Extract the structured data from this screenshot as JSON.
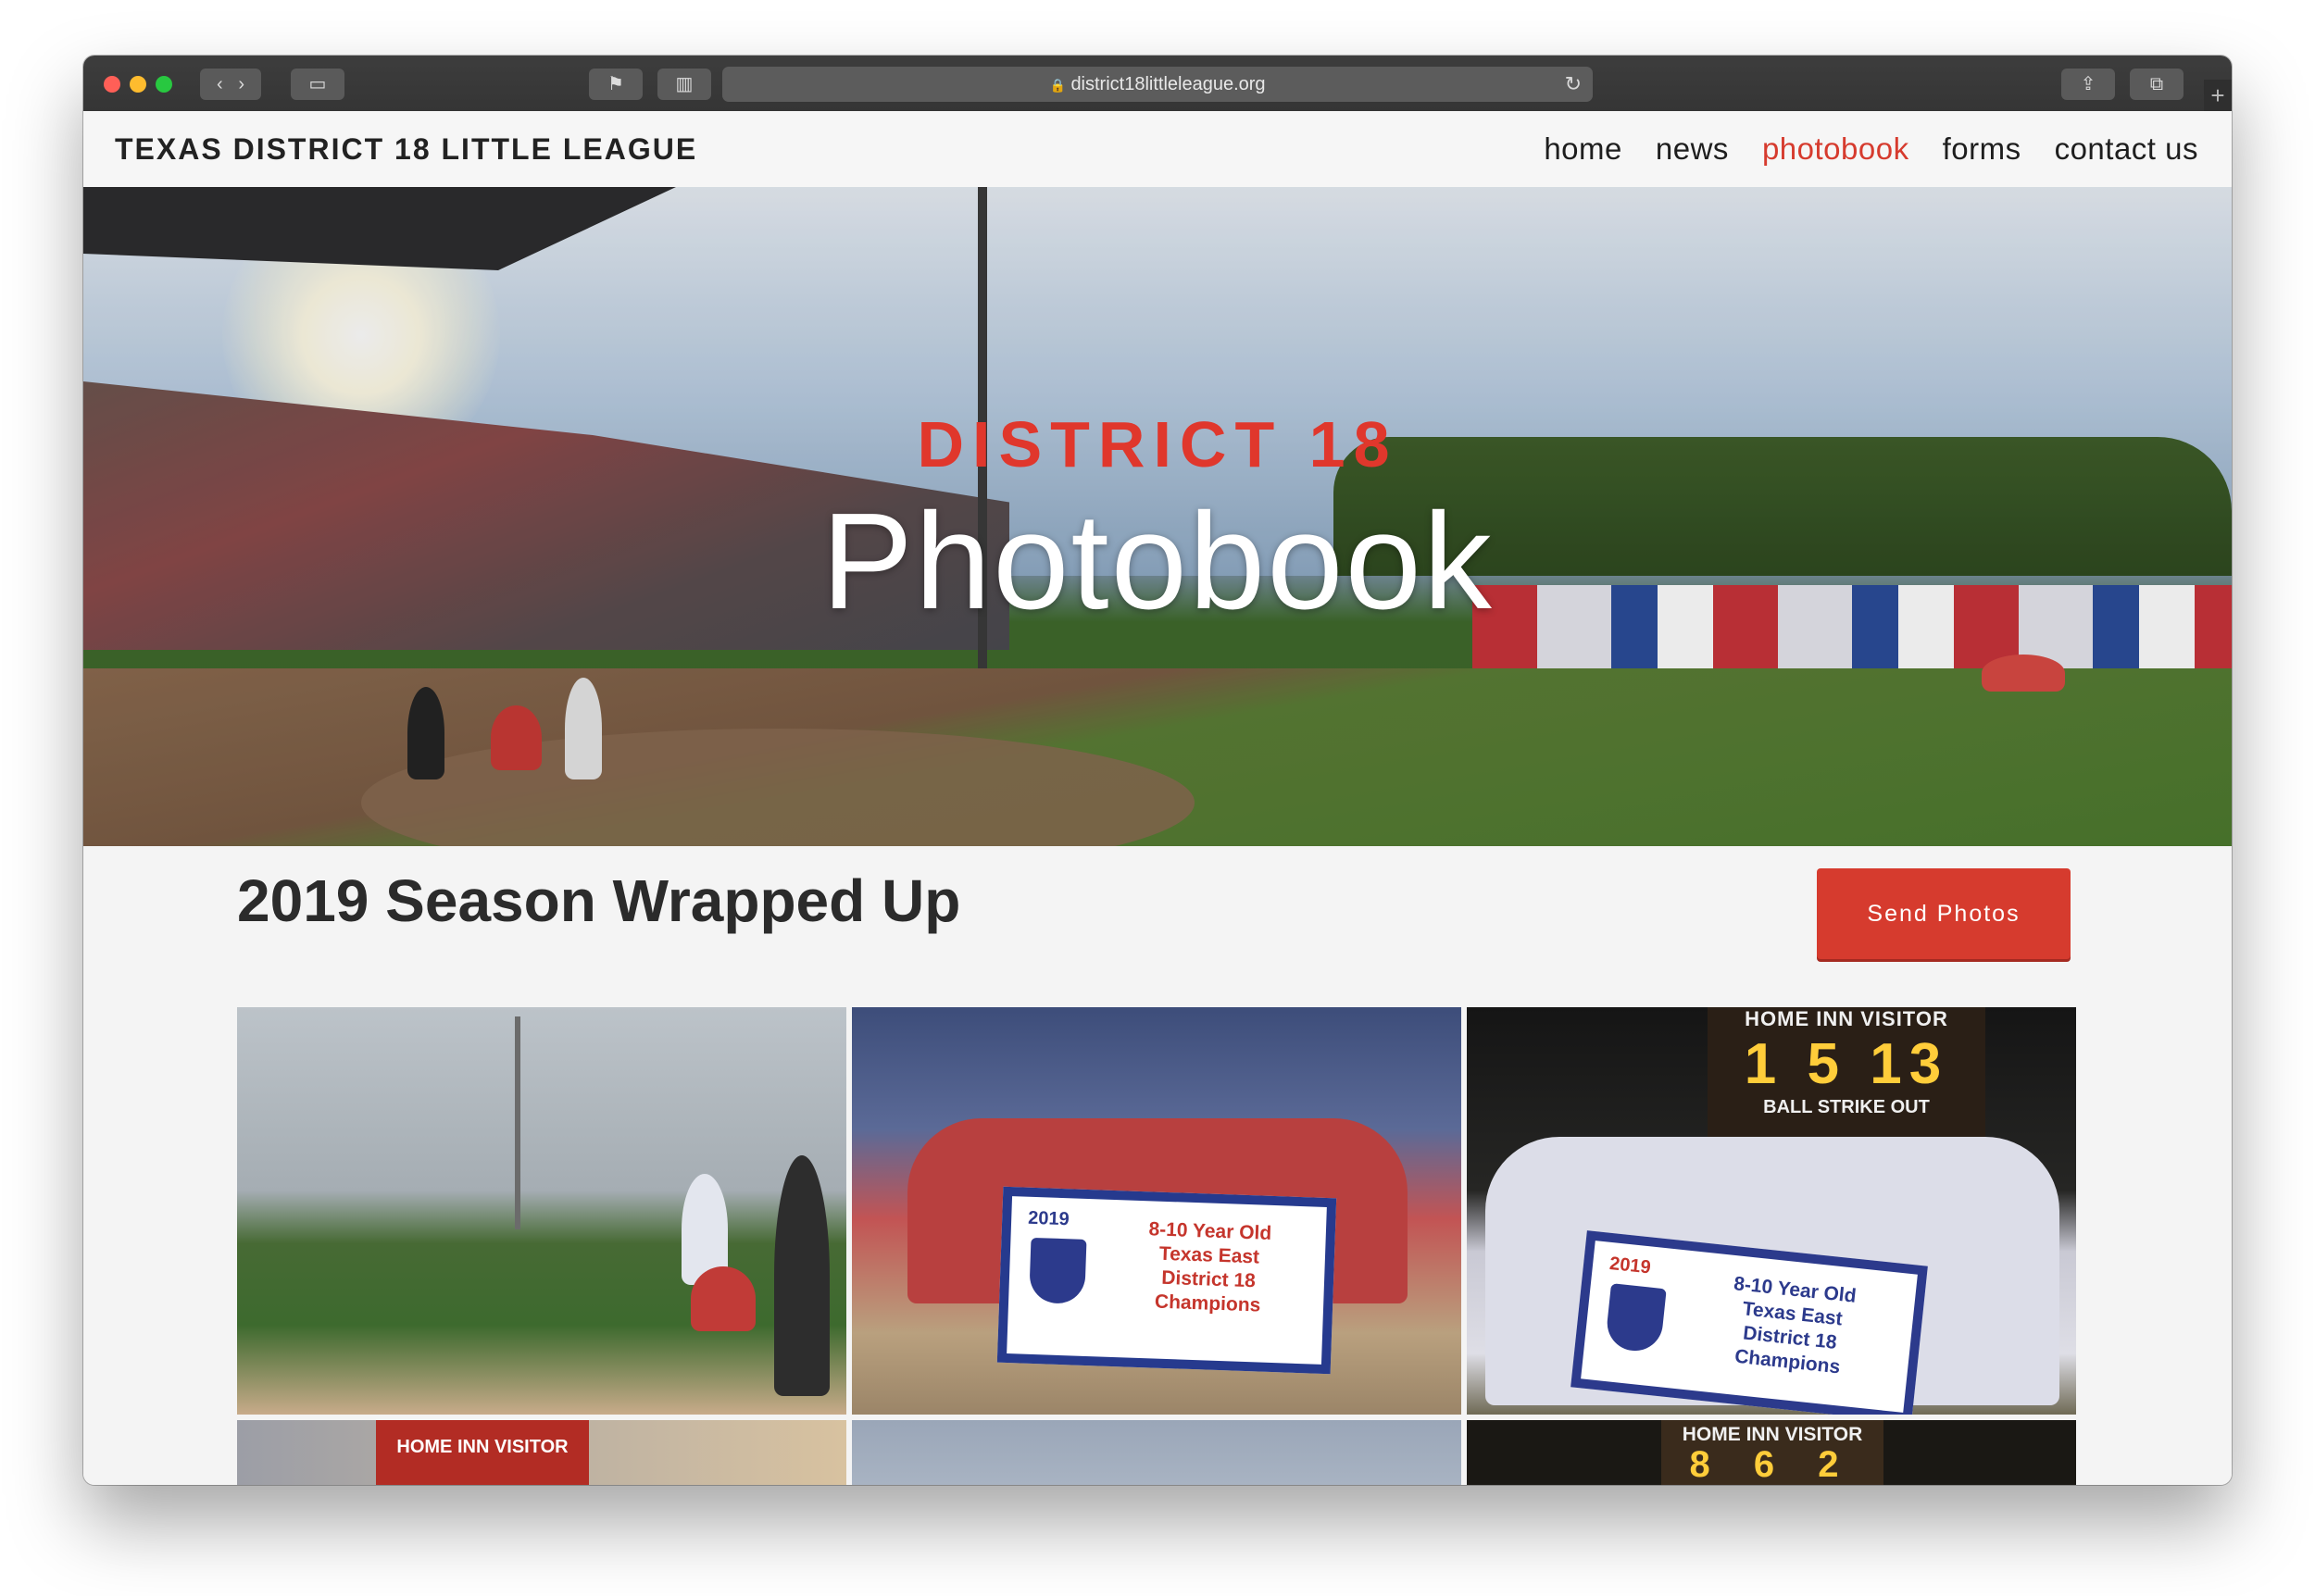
{
  "browser": {
    "url": "district18littleleague.org",
    "lock_icon": "🔒",
    "reload_icon": "↻",
    "plus_icon": "+"
  },
  "site": {
    "brand": "TEXAS DISTRICT 18 LITTLE LEAGUE",
    "nav": [
      "home",
      "news",
      "photobook",
      "forms",
      "contact us"
    ],
    "active_nav": "photobook",
    "accent_color": "#d63b2e"
  },
  "hero": {
    "kicker": "DISTRICT 18",
    "title": "Photobook"
  },
  "section": {
    "title": "2019 Season Wrapped Up",
    "send_button": "Send Photos"
  },
  "photos": {
    "photo2_banner": {
      "year": "2019",
      "lines": [
        "8-10 Year Old",
        "Texas East",
        "District 18",
        "Champions"
      ]
    },
    "photo3_banner": {
      "year": "2019",
      "lines": [
        "8-10 Year Old",
        "Texas East",
        "District 18",
        "Champions"
      ]
    },
    "photo3_scoreboard": {
      "header": "HOME  INN  VISITOR",
      "numbers": "1 5 13",
      "footer": "BALL  STRIKE  OUT"
    },
    "photo4_scoreboard": {
      "header": "HOME  INN  VISITOR"
    },
    "photo6_scoreboard": {
      "header": "HOME  INN  VISITOR",
      "numbers": "8 6 2"
    }
  }
}
